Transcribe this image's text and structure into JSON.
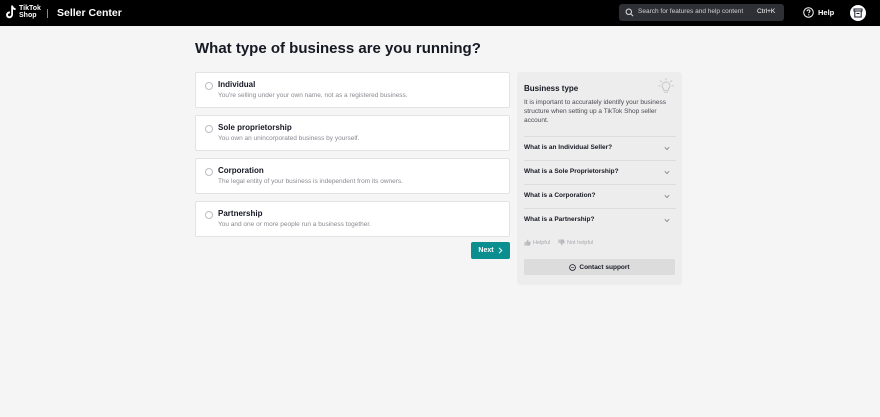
{
  "header": {
    "logo_line1": "TikTok",
    "logo_line2": "Shop",
    "app_title": "Seller Center",
    "search_placeholder": "Search for features and help content",
    "search_shortcut": "Ctrl+K",
    "help_label": "Help",
    "icons": [
      "tiktok-logo-icon",
      "search-icon",
      "help-icon",
      "shop-icon"
    ]
  },
  "main": {
    "title": "What type of business are you running?",
    "options": [
      {
        "label": "Individual",
        "description": "You're selling under your own name, not as a registered business."
      },
      {
        "label": "Sole proprietorship",
        "description": "You own an unincorporated business by yourself."
      },
      {
        "label": "Corporation",
        "description": "The legal entity of your business is independent from its owners."
      },
      {
        "label": "Partnership",
        "description": "You and one or more people run a business together."
      }
    ],
    "next_label": "Next"
  },
  "panel": {
    "title": "Business type",
    "text": "It is important to accurately identify your business structure when setting up a TikTok Shop seller account.",
    "faqs": [
      {
        "label": "What is an Individual Seller?"
      },
      {
        "label": "What is a Sole Proprietorship?"
      },
      {
        "label": "What is a Corporation?"
      },
      {
        "label": "What is a Partnership?"
      }
    ],
    "helpful_label": "Helpful",
    "not_helpful_label": "Not helpful",
    "contact_label": "Contact support"
  },
  "colors": {
    "accent": "#0b8e90",
    "topbar": "#000000",
    "background": "#f5f5f5"
  }
}
